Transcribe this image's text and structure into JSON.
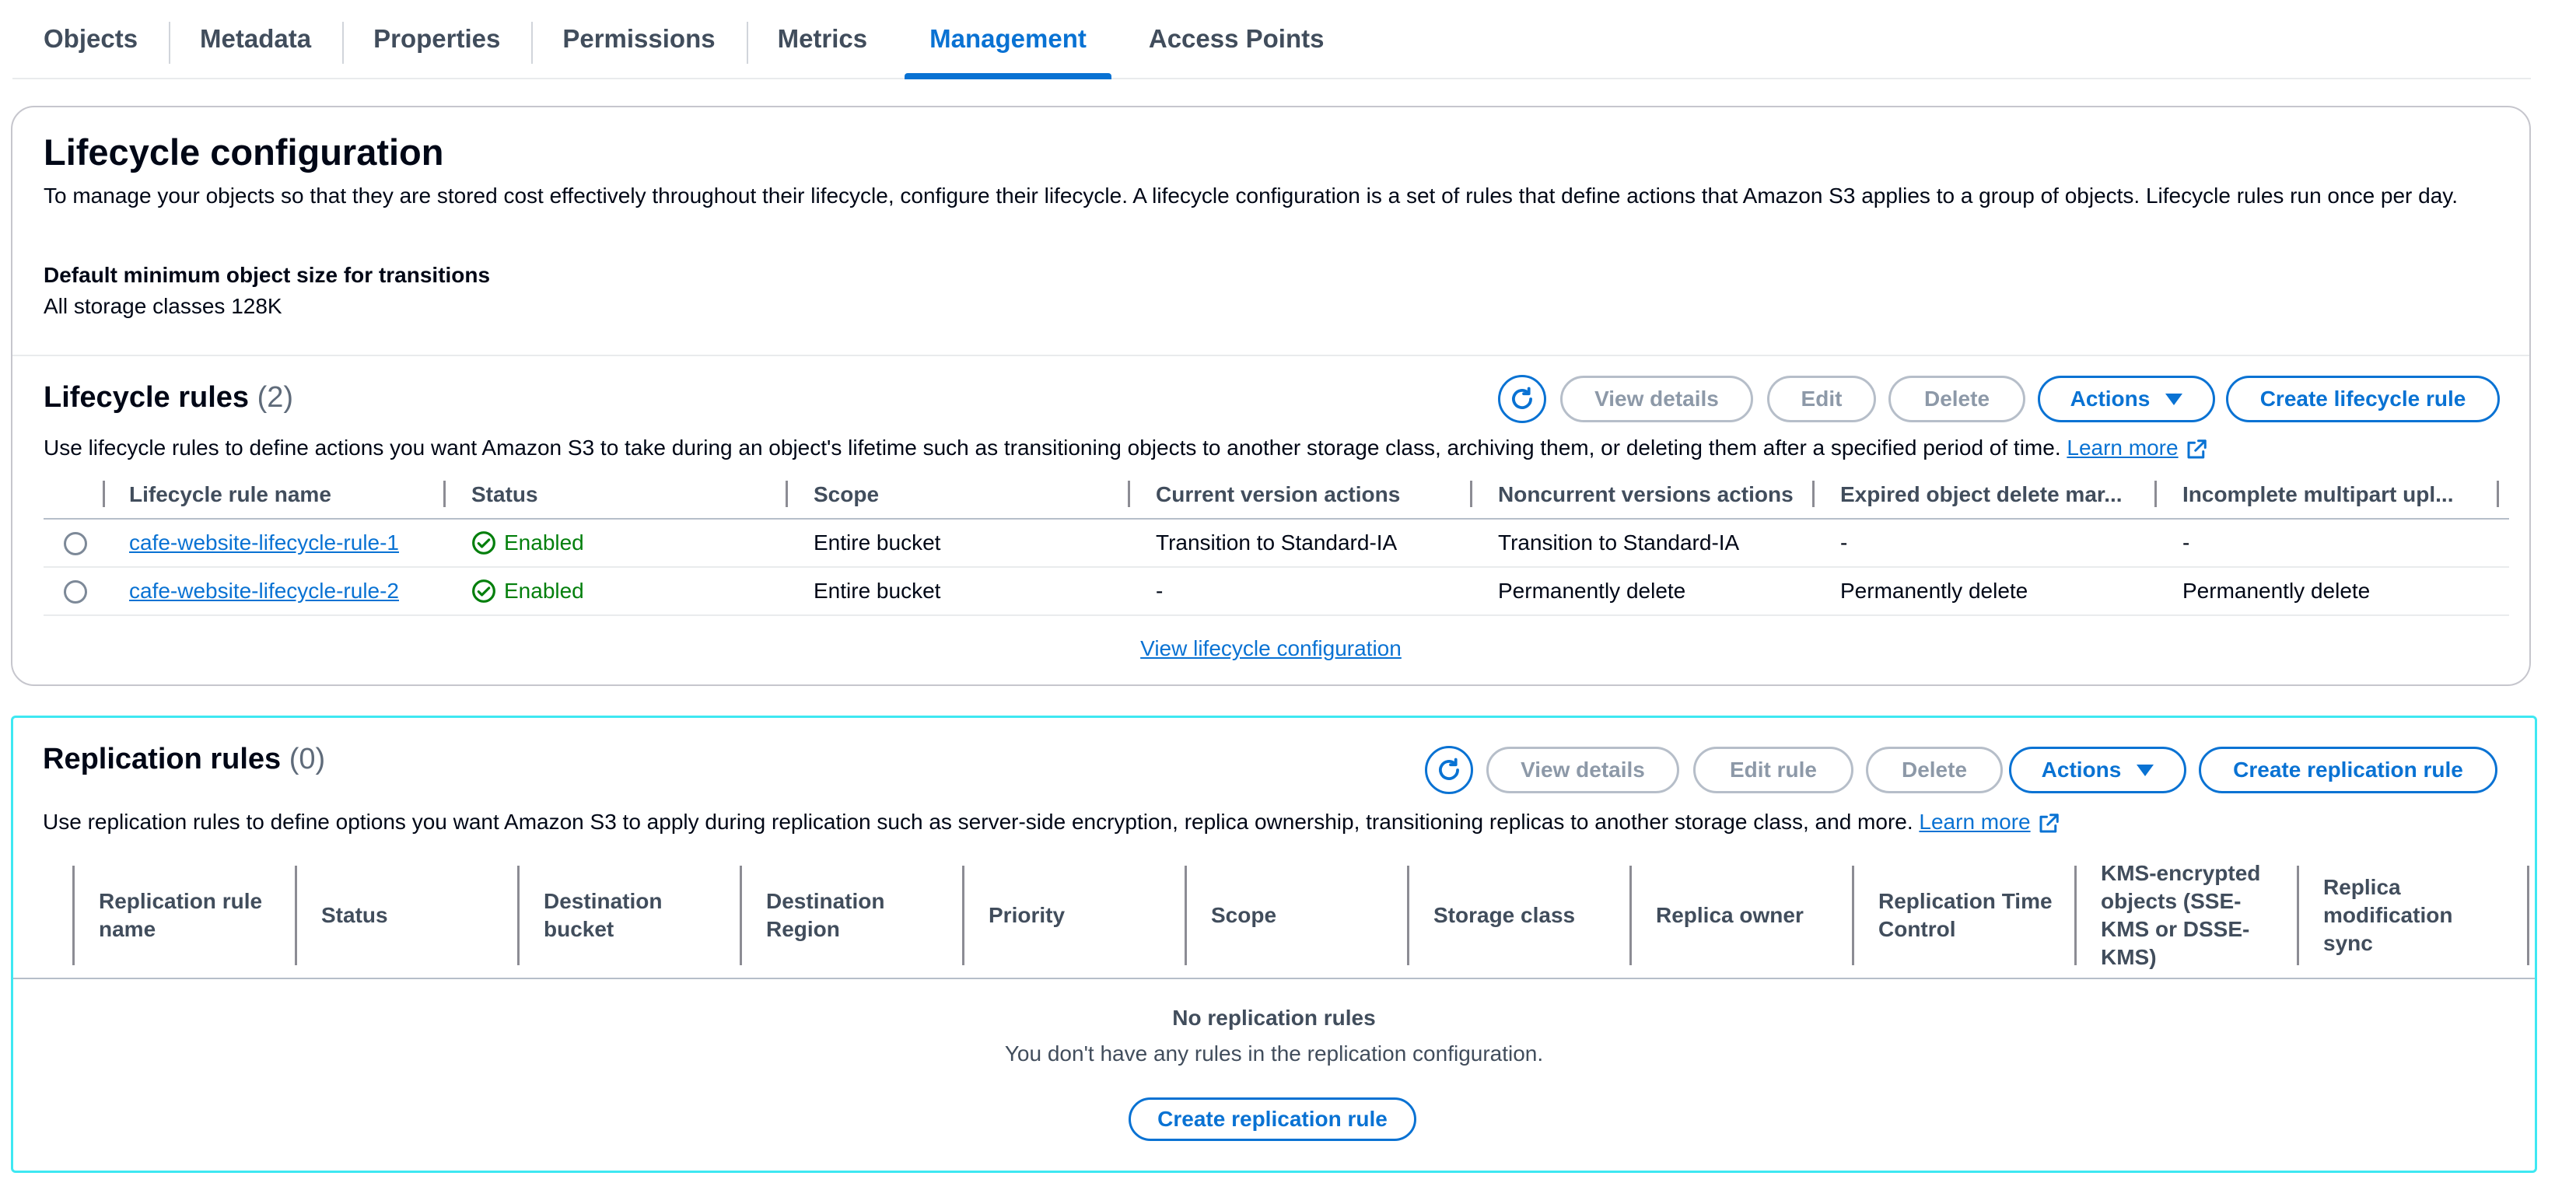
{
  "tabs": [
    {
      "label": "Objects"
    },
    {
      "label": "Metadata"
    },
    {
      "label": "Properties"
    },
    {
      "label": "Permissions"
    },
    {
      "label": "Metrics"
    },
    {
      "label": "Management",
      "active": true
    },
    {
      "label": "Access Points"
    }
  ],
  "lifecycle_config": {
    "title": "Lifecycle configuration",
    "description": "To manage your objects so that they are stored cost effectively throughout their lifecycle, configure their lifecycle. A lifecycle configuration is a set of rules that define actions that Amazon S3 applies to a group of objects. Lifecycle rules run once per day.",
    "min_size_label": "Default minimum object size for transitions",
    "min_size_value": "All storage classes 128K"
  },
  "lifecycle_rules": {
    "title": "Lifecycle rules",
    "count": "(2)",
    "buttons": {
      "view_details": "View details",
      "edit": "Edit",
      "delete": "Delete",
      "actions": "Actions",
      "create": "Create lifecycle rule"
    },
    "description": "Use lifecycle rules to define actions you want Amazon S3 to take during an object's lifetime such as transitioning objects to another storage class, archiving them, or deleting them after a specified period of time.",
    "learn_more": "Learn more",
    "columns": [
      "Lifecycle rule name",
      "Status",
      "Scope",
      "Current version actions",
      "Noncurrent versions actions",
      "Expired object delete mar...",
      "Incomplete multipart upl..."
    ],
    "rows": [
      {
        "name": "cafe-website-lifecycle-rule-1",
        "status": "Enabled",
        "scope": "Entire bucket",
        "current": "Transition to Standard-IA",
        "noncurrent": "Transition to Standard-IA",
        "expired": "-",
        "incomplete": "-"
      },
      {
        "name": "cafe-website-lifecycle-rule-2",
        "status": "Enabled",
        "scope": "Entire bucket",
        "current": "-",
        "noncurrent": "Permanently delete",
        "expired": "Permanently delete",
        "incomplete": "Permanently delete"
      }
    ],
    "view_config_link": "View lifecycle configuration"
  },
  "replication_rules": {
    "title": "Replication rules",
    "count": "(0)",
    "buttons": {
      "view_details": "View details",
      "edit": "Edit rule",
      "delete": "Delete",
      "actions": "Actions",
      "create": "Create replication rule"
    },
    "description": "Use replication rules to define options you want Amazon S3 to apply during replication such as server-side encryption, replica ownership, transitioning replicas to another storage class, and more.",
    "learn_more": "Learn more",
    "columns": [
      "Replication rule name",
      "Status",
      "Destination bucket",
      "Destination Region",
      "Priority",
      "Scope",
      "Storage class",
      "Replica owner",
      "Replication Time Control",
      "KMS-encrypted objects (SSE-KMS or DSSE-KMS)",
      "Replica modification sync"
    ],
    "empty_title": "No replication rules",
    "empty_desc": "You don't have any rules in the replication configuration.",
    "empty_button": "Create replication rule"
  },
  "colors": {
    "accent": "#0972d3",
    "success": "#037f0c",
    "highlight": "#3ee8f2"
  }
}
